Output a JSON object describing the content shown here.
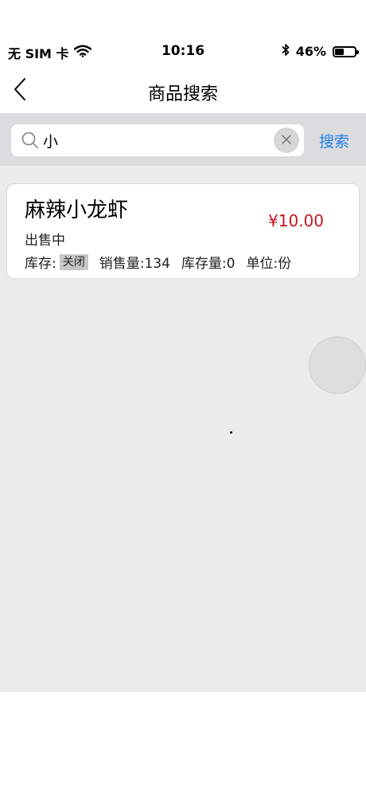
{
  "status": {
    "carrier": "无 SIM 卡",
    "time": "10:16",
    "battery": "46%",
    "battery_level": 0.46,
    "icons": [
      "wifi-icon",
      "bluetooth-icon",
      "battery-icon"
    ]
  },
  "nav": {
    "title": "商品搜索",
    "back_icon": "chevron-left-icon"
  },
  "search": {
    "value": "小",
    "placeholder": "",
    "action_label": "搜索",
    "icons": [
      "search-icon",
      "clear-icon"
    ]
  },
  "product": {
    "name": "麻辣小龙虾",
    "price": "¥10.00",
    "status": "出售中",
    "stock_label": "库存:",
    "stock_badge": "关闭",
    "sales": "销售量:134",
    "stock_qty": "库存量:0",
    "unit": "单位:份"
  },
  "colors": {
    "accent": "#1e7ee8",
    "price": "#c8141e",
    "background": "#ebebeb",
    "searchbar": "#dcdcde"
  }
}
